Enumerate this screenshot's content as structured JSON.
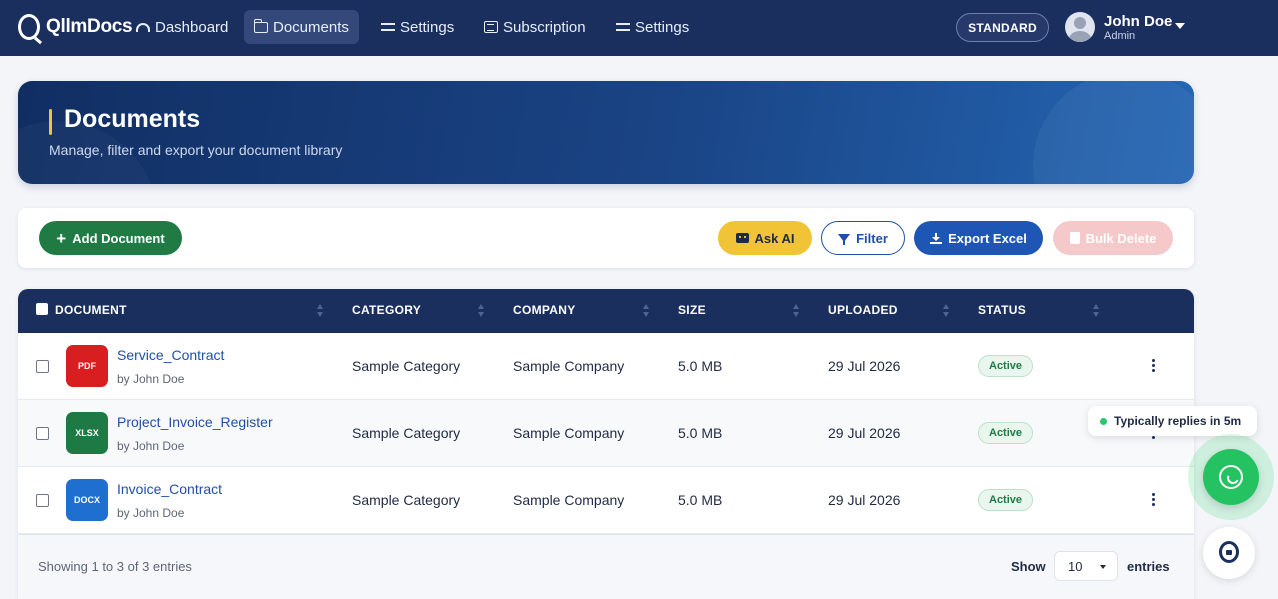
{
  "nav": {
    "brand": "QllmDocs",
    "items": [
      {
        "label": "Dashboard",
        "icon": "dashboard-gauge-icon"
      },
      {
        "label": "Documents",
        "icon": "folder-icon",
        "active": true
      },
      {
        "label": "Settings",
        "icon": "sliders-icon"
      },
      {
        "label": "Subscription",
        "icon": "receipt-icon"
      },
      {
        "label": "Settings",
        "icon": "sliders-icon"
      }
    ],
    "plan": "STANDARD",
    "user": {
      "name": "John Doe",
      "role": "Admin"
    }
  },
  "hero": {
    "title": "Documents",
    "subtitle": "Manage, filter and export your document library"
  },
  "toolbar": {
    "add_label": "Add Document",
    "ask_ai_label": "Ask AI",
    "filter_label": "Filter",
    "export_label": "Export Excel",
    "bulk_delete_label": "Bulk Delete"
  },
  "table": {
    "columns": [
      "DOCUMENT",
      "CATEGORY",
      "COMPANY",
      "SIZE",
      "UPLOADED",
      "STATUS"
    ],
    "rows": [
      {
        "type": "PDF",
        "type_color": "#d81e1e",
        "name": "Service_Contract",
        "by": "by John Doe",
        "category": "Sample Category",
        "company": "Sample Company",
        "size": "5.0 MB",
        "uploaded": "29 Jul 2026",
        "status": "Active"
      },
      {
        "type": "XLSX",
        "type_color": "#1e7a45",
        "name": "Project_Invoice_Register",
        "by": "by John Doe",
        "category": "Sample Category",
        "company": "Sample Company",
        "size": "5.0 MB",
        "uploaded": "29 Jul 2026",
        "status": "Active"
      },
      {
        "type": "DOCX",
        "type_color": "#1e6fd0",
        "name": "Invoice_Contract",
        "by": "by John Doe",
        "category": "Sample Category",
        "company": "Sample Company",
        "size": "5.0 MB",
        "uploaded": "29 Jul 2026",
        "status": "Active"
      }
    ],
    "footer": {
      "showing": "Showing 1 to 3 of 3 entries",
      "show_label": "Show",
      "page_size": "10",
      "entries_label": "entries"
    }
  },
  "widgets": {
    "chat_tip": "Typically replies in 5m"
  },
  "colors": {
    "nav_bg": "#1b2f5e",
    "accent_yellow": "#f1c437",
    "primary_blue": "#1e56b5",
    "success_green": "#1f7a44",
    "danger_light": "#f5c9c9",
    "whatsapp_green": "#25c262"
  }
}
